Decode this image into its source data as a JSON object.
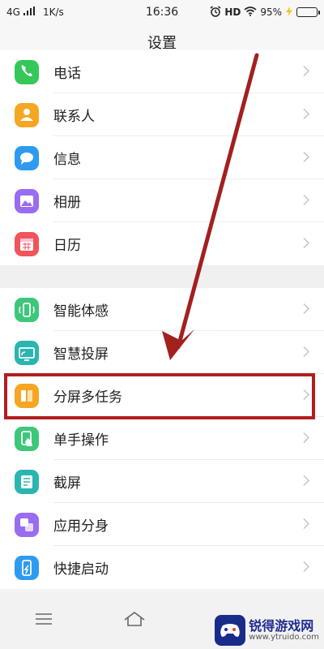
{
  "status": {
    "network": "4G",
    "speed": "1K/s",
    "time": "16:36",
    "hd": "HD",
    "battery_text": "95%",
    "battery_level": 0.95
  },
  "header": {
    "title": "设置"
  },
  "groups": [
    {
      "items": [
        {
          "label": "电话",
          "icon": "phone-icon",
          "color": "#35c759"
        },
        {
          "label": "联系人",
          "icon": "contacts-icon",
          "color": "#f5a623"
        },
        {
          "label": "信息",
          "icon": "messages-icon",
          "color": "#2f9bf0"
        },
        {
          "label": "相册",
          "icon": "album-icon",
          "color": "#9a6cf0"
        },
        {
          "label": "日历",
          "icon": "calendar-icon",
          "color": "#f0555a"
        }
      ]
    },
    {
      "items": [
        {
          "label": "智能体感",
          "icon": "motion-sensing-icon",
          "color": "#3dc77a"
        },
        {
          "label": "智慧投屏",
          "icon": "screen-cast-icon",
          "color": "#2bb5b0"
        },
        {
          "label": "分屏多任务",
          "icon": "split-screen-icon",
          "color": "#f5a623"
        },
        {
          "label": "单手操作",
          "icon": "one-hand-icon",
          "color": "#3dc77a"
        },
        {
          "label": "截屏",
          "icon": "screenshot-icon",
          "color": "#2bb5b0"
        },
        {
          "label": "应用分身",
          "icon": "app-clone-icon",
          "color": "#9a6cf0"
        },
        {
          "label": "快捷启动",
          "icon": "quick-launch-icon",
          "color": "#2f9bf0"
        }
      ]
    }
  ],
  "bottom_nav": {
    "menu_icon": "menu-icon",
    "home_icon": "home-icon"
  },
  "watermark": {
    "title": "锐得游戏网",
    "url": "www.ytruido.com"
  },
  "colors": {
    "highlight": "#b21e1e",
    "arrow": "#a3201f"
  }
}
